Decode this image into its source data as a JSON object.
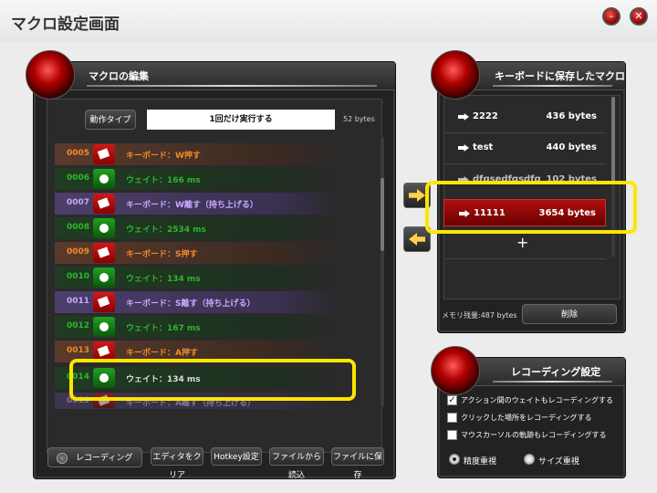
{
  "window": {
    "title": "マクロ設定画面"
  },
  "editor": {
    "title": "マクロの編集",
    "action_type_label": "動作タイプ",
    "action_type_value": "1回だけ実行する",
    "size": "52 bytes",
    "rows": [
      {
        "num": "0005",
        "type": "key",
        "text": "キーボード：W押す"
      },
      {
        "num": "0006",
        "type": "wait",
        "text": "ウェイト：166 ms"
      },
      {
        "num": "0007",
        "type": "rel",
        "text": "キーボード：W離す（持ち上げる）"
      },
      {
        "num": "0008",
        "type": "wait",
        "text": "ウェイト：2534 ms"
      },
      {
        "num": "0009",
        "type": "key",
        "text": "キーボード：S押す"
      },
      {
        "num": "0010",
        "type": "wait",
        "text": "ウェイト：134 ms"
      },
      {
        "num": "0011",
        "type": "rel",
        "text": "キーボード：S離す（持ち上げる）"
      },
      {
        "num": "0012",
        "type": "wait",
        "text": "ウェイト：167 ms"
      },
      {
        "num": "0013",
        "type": "key",
        "text": "キーボード：A押す"
      },
      {
        "num": "0014",
        "type": "wait",
        "text": "ウェイト：134 ms"
      },
      {
        "num": "0015",
        "type": "rel",
        "text": "キーボード：A離す（持ち上げる）"
      }
    ],
    "buttons": {
      "record": "レコーディング",
      "clear": "エディタをクリア",
      "hotkey": "Hotkey設定",
      "load": "ファイルから読込",
      "save": "ファイルに保存"
    }
  },
  "saved": {
    "title": "キーボードに保存したマクロ",
    "items": [
      {
        "name": "2222",
        "size": "436 bytes"
      },
      {
        "name": "test",
        "size": "440 bytes"
      },
      {
        "name": "dfgsedfgsdfg",
        "size": "102 bytes"
      },
      {
        "name": "11111",
        "size": "3654 bytes"
      }
    ],
    "add": "+",
    "memory": "メモリ残量:487 bytes",
    "delete": "削除"
  },
  "recording": {
    "title": "レコーディング設定",
    "options": [
      {
        "label": "アクション間のウェイトもレコーディングする",
        "checked": true
      },
      {
        "label": "クリックした場所をレコーディングする",
        "checked": false
      },
      {
        "label": "マウスカーソルの軌跡もレコーディングする",
        "checked": false
      }
    ],
    "radios": [
      {
        "label": "精度重視",
        "selected": true
      },
      {
        "label": "サイズ重視",
        "selected": false
      }
    ]
  },
  "colors": {
    "key": "#f08a2a",
    "wait": "#2db52d",
    "release": "#c8a8ff",
    "selected": "#b01010",
    "highlight": "#ffe600"
  }
}
